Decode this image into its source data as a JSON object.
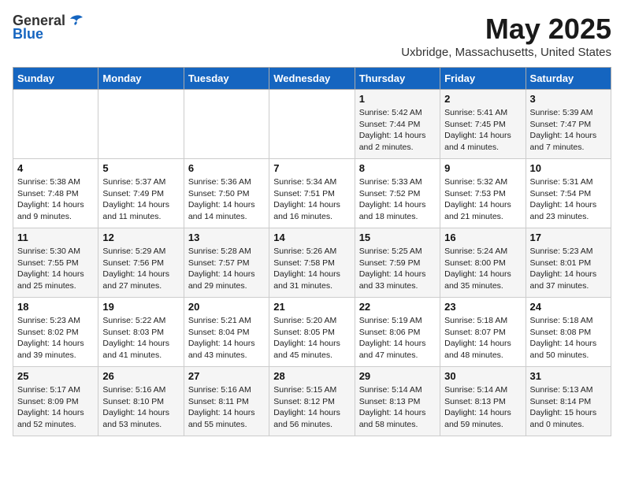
{
  "logo": {
    "general": "General",
    "blue": "Blue"
  },
  "title": "May 2025",
  "subtitle": "Uxbridge, Massachusetts, United States",
  "header": {
    "days": [
      "Sunday",
      "Monday",
      "Tuesday",
      "Wednesday",
      "Thursday",
      "Friday",
      "Saturday"
    ]
  },
  "weeks": [
    {
      "cells": [
        {
          "day": "",
          "info": ""
        },
        {
          "day": "",
          "info": ""
        },
        {
          "day": "",
          "info": ""
        },
        {
          "day": "",
          "info": ""
        },
        {
          "day": "1",
          "info": "Sunrise: 5:42 AM\nSunset: 7:44 PM\nDaylight: 14 hours\nand 2 minutes."
        },
        {
          "day": "2",
          "info": "Sunrise: 5:41 AM\nSunset: 7:45 PM\nDaylight: 14 hours\nand 4 minutes."
        },
        {
          "day": "3",
          "info": "Sunrise: 5:39 AM\nSunset: 7:47 PM\nDaylight: 14 hours\nand 7 minutes."
        }
      ]
    },
    {
      "cells": [
        {
          "day": "4",
          "info": "Sunrise: 5:38 AM\nSunset: 7:48 PM\nDaylight: 14 hours\nand 9 minutes."
        },
        {
          "day": "5",
          "info": "Sunrise: 5:37 AM\nSunset: 7:49 PM\nDaylight: 14 hours\nand 11 minutes."
        },
        {
          "day": "6",
          "info": "Sunrise: 5:36 AM\nSunset: 7:50 PM\nDaylight: 14 hours\nand 14 minutes."
        },
        {
          "day": "7",
          "info": "Sunrise: 5:34 AM\nSunset: 7:51 PM\nDaylight: 14 hours\nand 16 minutes."
        },
        {
          "day": "8",
          "info": "Sunrise: 5:33 AM\nSunset: 7:52 PM\nDaylight: 14 hours\nand 18 minutes."
        },
        {
          "day": "9",
          "info": "Sunrise: 5:32 AM\nSunset: 7:53 PM\nDaylight: 14 hours\nand 21 minutes."
        },
        {
          "day": "10",
          "info": "Sunrise: 5:31 AM\nSunset: 7:54 PM\nDaylight: 14 hours\nand 23 minutes."
        }
      ]
    },
    {
      "cells": [
        {
          "day": "11",
          "info": "Sunrise: 5:30 AM\nSunset: 7:55 PM\nDaylight: 14 hours\nand 25 minutes."
        },
        {
          "day": "12",
          "info": "Sunrise: 5:29 AM\nSunset: 7:56 PM\nDaylight: 14 hours\nand 27 minutes."
        },
        {
          "day": "13",
          "info": "Sunrise: 5:28 AM\nSunset: 7:57 PM\nDaylight: 14 hours\nand 29 minutes."
        },
        {
          "day": "14",
          "info": "Sunrise: 5:26 AM\nSunset: 7:58 PM\nDaylight: 14 hours\nand 31 minutes."
        },
        {
          "day": "15",
          "info": "Sunrise: 5:25 AM\nSunset: 7:59 PM\nDaylight: 14 hours\nand 33 minutes."
        },
        {
          "day": "16",
          "info": "Sunrise: 5:24 AM\nSunset: 8:00 PM\nDaylight: 14 hours\nand 35 minutes."
        },
        {
          "day": "17",
          "info": "Sunrise: 5:23 AM\nSunset: 8:01 PM\nDaylight: 14 hours\nand 37 minutes."
        }
      ]
    },
    {
      "cells": [
        {
          "day": "18",
          "info": "Sunrise: 5:23 AM\nSunset: 8:02 PM\nDaylight: 14 hours\nand 39 minutes."
        },
        {
          "day": "19",
          "info": "Sunrise: 5:22 AM\nSunset: 8:03 PM\nDaylight: 14 hours\nand 41 minutes."
        },
        {
          "day": "20",
          "info": "Sunrise: 5:21 AM\nSunset: 8:04 PM\nDaylight: 14 hours\nand 43 minutes."
        },
        {
          "day": "21",
          "info": "Sunrise: 5:20 AM\nSunset: 8:05 PM\nDaylight: 14 hours\nand 45 minutes."
        },
        {
          "day": "22",
          "info": "Sunrise: 5:19 AM\nSunset: 8:06 PM\nDaylight: 14 hours\nand 47 minutes."
        },
        {
          "day": "23",
          "info": "Sunrise: 5:18 AM\nSunset: 8:07 PM\nDaylight: 14 hours\nand 48 minutes."
        },
        {
          "day": "24",
          "info": "Sunrise: 5:18 AM\nSunset: 8:08 PM\nDaylight: 14 hours\nand 50 minutes."
        }
      ]
    },
    {
      "cells": [
        {
          "day": "25",
          "info": "Sunrise: 5:17 AM\nSunset: 8:09 PM\nDaylight: 14 hours\nand 52 minutes."
        },
        {
          "day": "26",
          "info": "Sunrise: 5:16 AM\nSunset: 8:10 PM\nDaylight: 14 hours\nand 53 minutes."
        },
        {
          "day": "27",
          "info": "Sunrise: 5:16 AM\nSunset: 8:11 PM\nDaylight: 14 hours\nand 55 minutes."
        },
        {
          "day": "28",
          "info": "Sunrise: 5:15 AM\nSunset: 8:12 PM\nDaylight: 14 hours\nand 56 minutes."
        },
        {
          "day": "29",
          "info": "Sunrise: 5:14 AM\nSunset: 8:13 PM\nDaylight: 14 hours\nand 58 minutes."
        },
        {
          "day": "30",
          "info": "Sunrise: 5:14 AM\nSunset: 8:13 PM\nDaylight: 14 hours\nand 59 minutes."
        },
        {
          "day": "31",
          "info": "Sunrise: 5:13 AM\nSunset: 8:14 PM\nDaylight: 15 hours\nand 0 minutes."
        }
      ]
    }
  ]
}
